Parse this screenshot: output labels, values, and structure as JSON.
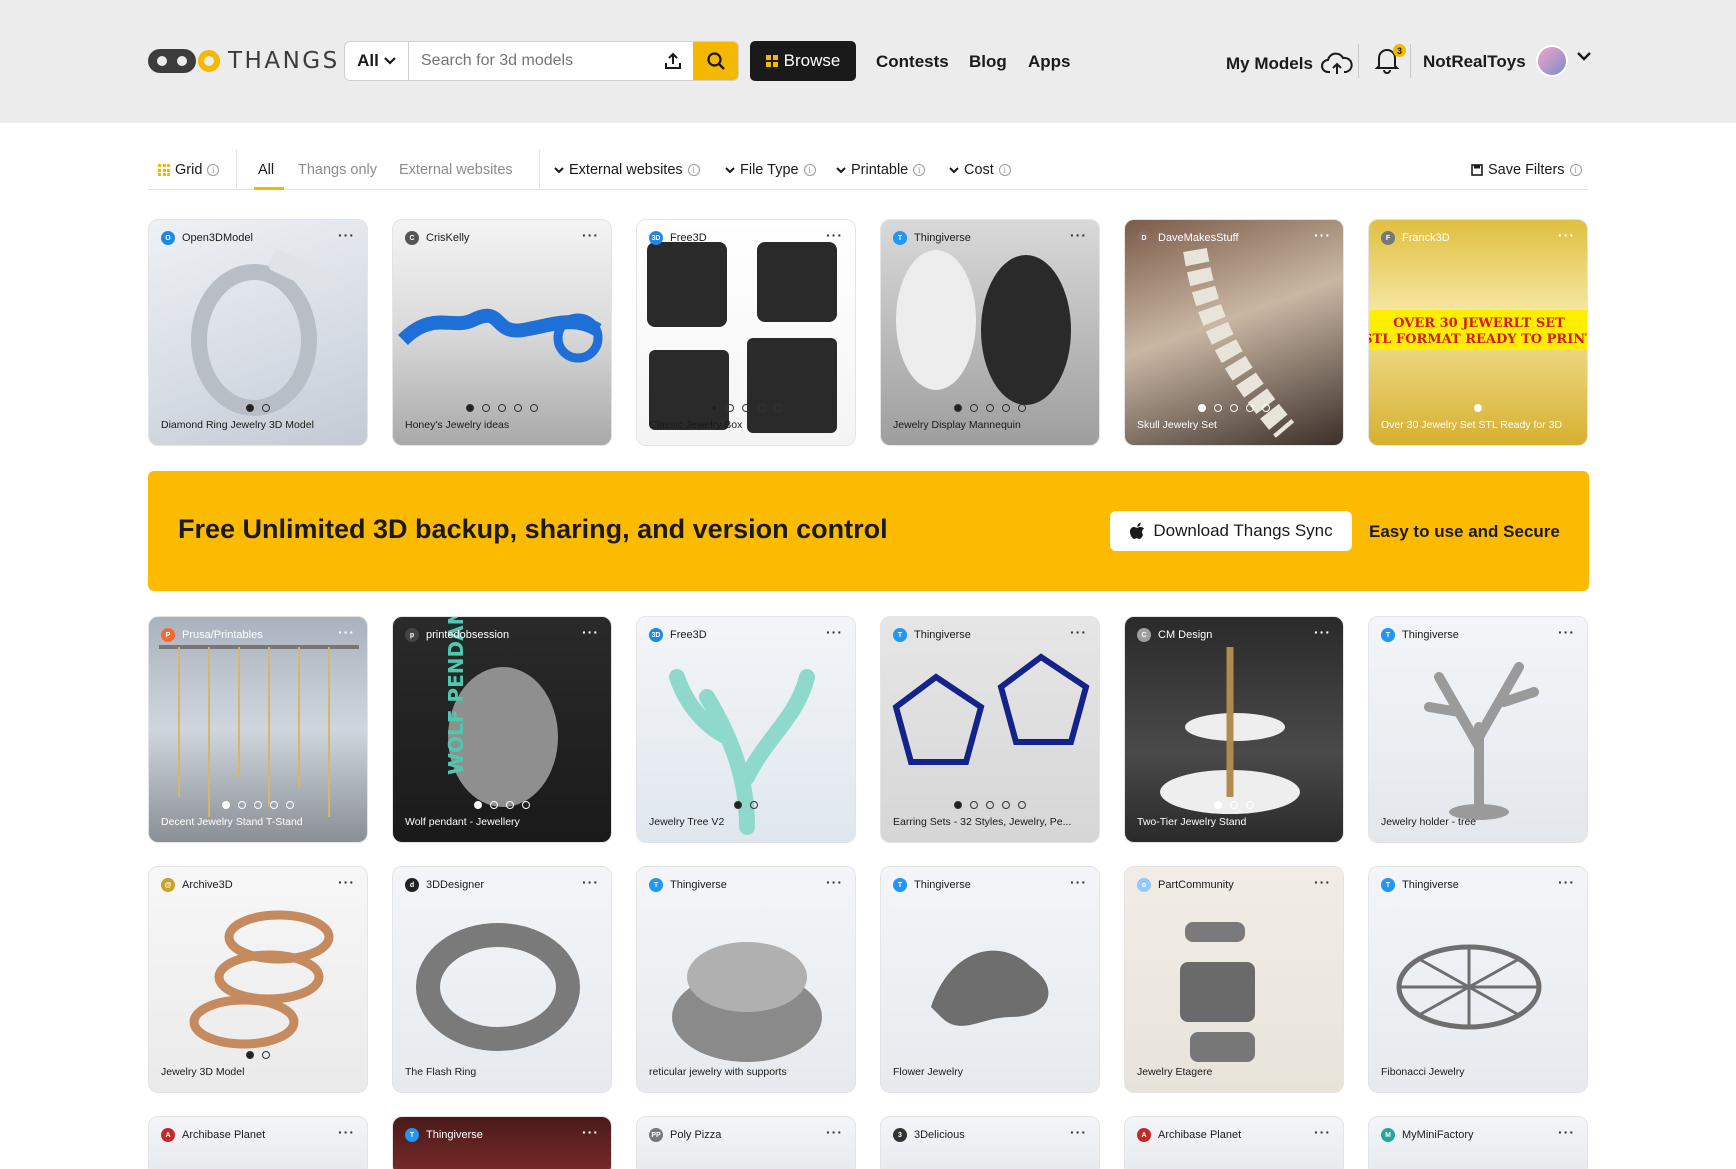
{
  "header": {
    "logo_text": "THANGS",
    "search": {
      "scope": "All",
      "placeholder": "Search for 3d models"
    },
    "browse_label": "Browse",
    "nav": [
      "Contests",
      "Blog",
      "Apps"
    ],
    "my_models": "My Models",
    "notification_count": "3",
    "username": "NotRealToys"
  },
  "filters": {
    "view": "Grid",
    "tabs": [
      "All",
      "Thangs only",
      "External websites"
    ],
    "active_tab": "All",
    "dropdowns": [
      "External websites",
      "File Type",
      "Printable",
      "Cost"
    ],
    "save": "Save Filters"
  },
  "banner": {
    "title": "Free Unlimited 3D backup, sharing, and version control",
    "button": "Download Thangs Sync",
    "subtitle": "Easy to use and Secure"
  },
  "colors": {
    "accent": "#fdbb00",
    "dark": "#1a1a1a",
    "header_bg": "#ececec"
  },
  "rows": [
    [
      {
        "source": "Open3DModel",
        "icon": "O",
        "icon_color": "#1e88e5",
        "title": "Diamond Ring Jewelry 3D Model",
        "dots": 2,
        "active": 0
      },
      {
        "source": "CrisKelly",
        "icon": "C",
        "icon_color": "#555555",
        "title": "Honey's Jewelry ideas",
        "dots": 5,
        "active": 0
      },
      {
        "source": "Free3D",
        "icon": "3D",
        "icon_color": "#1e88e5",
        "title": "Classic Jewelry Box",
        "dots": 5,
        "active": 0
      },
      {
        "source": "Thingiverse",
        "icon": "T",
        "icon_color": "#2196f3",
        "title": "Jewelry Display Mannequin",
        "dots": 5,
        "active": 0
      },
      {
        "source": "DaveMakesStuff",
        "icon": "D",
        "icon_color": "#8d6e63",
        "title": "Skull Jewelry Set",
        "dots": 5,
        "active": 0
      },
      {
        "source": "Franck3D",
        "icon": "F",
        "icon_color": "#777777",
        "title": "Over 30 Jewelry Set STL Ready for 3D",
        "dots": 1,
        "active": 0
      }
    ],
    [
      {
        "source": "Prusa/Printables",
        "icon": "P",
        "icon_color": "#fa6831",
        "title": "Decent Jewelry Stand T-Stand",
        "dots": 5,
        "active": 0
      },
      {
        "source": "printedobsession",
        "icon": "p",
        "icon_color": "#444444",
        "title": "Wolf pendant - Jewellery",
        "dots": 4,
        "active": 0
      },
      {
        "source": "Free3D",
        "icon": "3D",
        "icon_color": "#1e88e5",
        "title": "Jewelry Tree V2",
        "dots": 2,
        "active": 0
      },
      {
        "source": "Thingiverse",
        "icon": "T",
        "icon_color": "#2196f3",
        "title": "Earring Sets - 32 Styles, Jewelry, Pe...",
        "dots": 5,
        "active": 0
      },
      {
        "source": "CM Design",
        "icon": "C",
        "icon_color": "#9e9e9e",
        "title": "Two-Tier Jewelry Stand",
        "dots": 3,
        "active": 0
      },
      {
        "source": "Thingiverse",
        "icon": "T",
        "icon_color": "#2196f3",
        "title": "Jewelry holder - tree",
        "dots": 0,
        "active": 0
      }
    ],
    [
      {
        "source": "Archive3D",
        "icon": "@",
        "icon_color": "#c9a227",
        "title": "Jewelry 3D Model",
        "dots": 2,
        "active": 0
      },
      {
        "source": "3DDesigner",
        "icon": "d",
        "icon_color": "#222222",
        "title": "The Flash Ring",
        "dots": 0,
        "active": 0
      },
      {
        "source": "Thingiverse",
        "icon": "T",
        "icon_color": "#2196f3",
        "title": "reticular jewelry with supports",
        "dots": 0,
        "active": 0
      },
      {
        "source": "Thingiverse",
        "icon": "T",
        "icon_color": "#2196f3",
        "title": "Flower Jewelry",
        "dots": 0,
        "active": 0
      },
      {
        "source": "PartCommunity",
        "icon": "o",
        "icon_color": "#90caf9",
        "title": "Jewelry Etagere",
        "dots": 0,
        "active": 0
      },
      {
        "source": "Thingiverse",
        "icon": "T",
        "icon_color": "#2196f3",
        "title": "Fibonacci Jewelry",
        "dots": 0,
        "active": 0
      }
    ],
    [
      {
        "source": "Archibase Planet",
        "icon": "A",
        "icon_color": "#c62828",
        "title": "",
        "dots": 0,
        "active": 0
      },
      {
        "source": "Thingiverse",
        "icon": "T",
        "icon_color": "#2196f3",
        "title": "",
        "dots": 0,
        "active": 0
      },
      {
        "source": "Poly Pizza",
        "icon": "PP",
        "icon_color": "#777777",
        "title": "",
        "dots": 0,
        "active": 0
      },
      {
        "source": "3Delicious",
        "icon": "3",
        "icon_color": "#333333",
        "title": "",
        "dots": 0,
        "active": 0
      },
      {
        "source": "Archibase Planet",
        "icon": "A",
        "icon_color": "#c62828",
        "title": "",
        "dots": 0,
        "active": 0
      },
      {
        "source": "MyMiniFactory",
        "icon": "M",
        "icon_color": "#26a69a",
        "title": "",
        "dots": 0,
        "active": 0
      }
    ]
  ]
}
